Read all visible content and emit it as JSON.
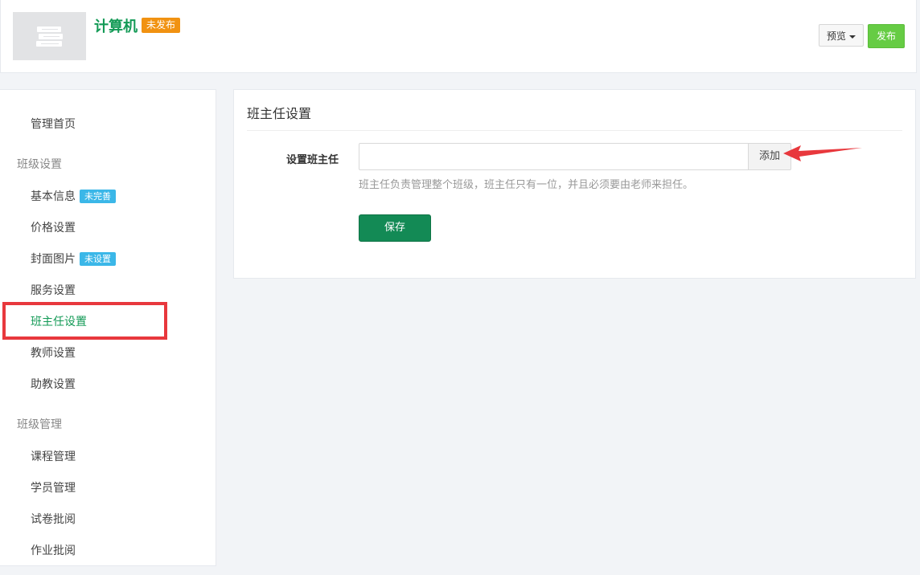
{
  "header": {
    "title": "计算机",
    "status_badge": "未发布",
    "preview_label": "预览",
    "publish_label": "发布"
  },
  "sidebar": {
    "items": [
      {
        "label": "管理首页",
        "type": "item"
      },
      {
        "label": "班级设置",
        "type": "group"
      },
      {
        "label": "基本信息",
        "type": "item",
        "badge": "未完善"
      },
      {
        "label": "价格设置",
        "type": "item"
      },
      {
        "label": "封面图片",
        "type": "item",
        "badge": "未设置"
      },
      {
        "label": "服务设置",
        "type": "item"
      },
      {
        "label": "班主任设置",
        "type": "item",
        "active": true
      },
      {
        "label": "教师设置",
        "type": "item"
      },
      {
        "label": "助教设置",
        "type": "item"
      },
      {
        "label": "班级管理",
        "type": "group"
      },
      {
        "label": "课程管理",
        "type": "item"
      },
      {
        "label": "学员管理",
        "type": "item"
      },
      {
        "label": "试卷批阅",
        "type": "item"
      },
      {
        "label": "作业批阅",
        "type": "item"
      }
    ]
  },
  "main": {
    "title": "班主任设置",
    "field_label": "设置班主任",
    "input_value": "",
    "add_label": "添加",
    "help_text": "班主任负责管理整个班级，班主任只有一位，并且必须要由老师来担任。",
    "save_label": "保存"
  },
  "colors": {
    "brand_green": "#139a56",
    "publish_green": "#66cc44",
    "badge_orange": "#f19211",
    "badge_blue": "#3bb7e8",
    "annotation_red": "#e8383d"
  },
  "icons": {
    "cover": "book-stack-icon",
    "preview_caret": "caret-down-icon",
    "annotation": "red-arrow-icon"
  }
}
